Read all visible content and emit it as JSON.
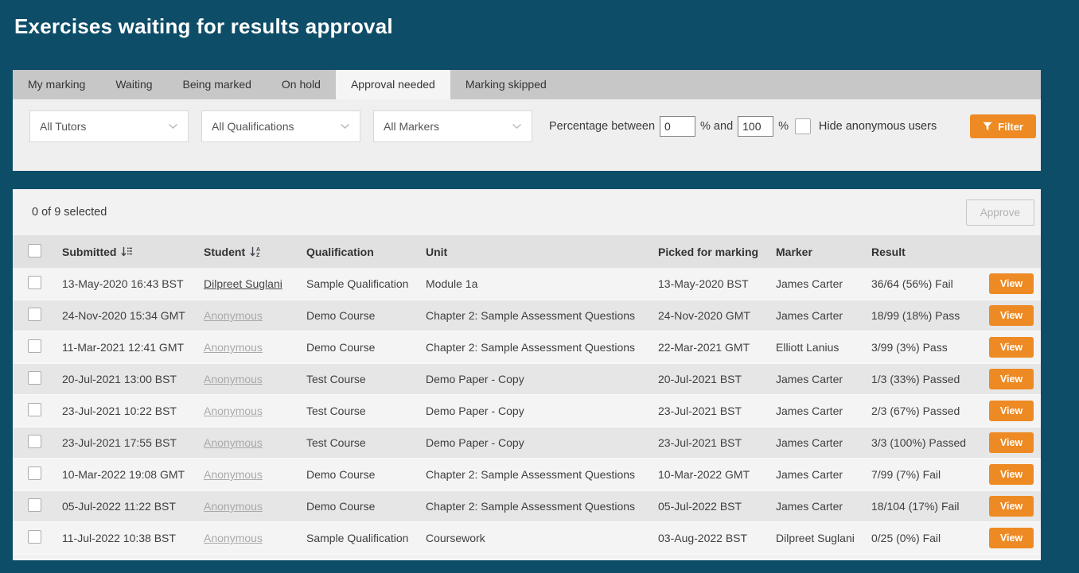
{
  "page": {
    "title": "Exercises waiting for results approval"
  },
  "tabs": [
    {
      "label": "My marking",
      "active": false
    },
    {
      "label": "Waiting",
      "active": false
    },
    {
      "label": "Being marked",
      "active": false
    },
    {
      "label": "On hold",
      "active": false
    },
    {
      "label": "Approval needed",
      "active": true
    },
    {
      "label": "Marking skipped",
      "active": false
    }
  ],
  "filters": {
    "tutors_dropdown": "All Tutors",
    "qualifications_dropdown": "All Qualifications",
    "markers_dropdown": "All Markers",
    "percentage_label": "Percentage between",
    "percentage_min": "0",
    "percent_and_label": "% and",
    "percentage_max": "100",
    "percent_label": "%",
    "hide_anonymous_label": "Hide anonymous users",
    "filter_button_label": "Filter"
  },
  "selection_bar": {
    "summary": "0 of 9 selected",
    "approve_button_label": "Approve"
  },
  "table": {
    "headers": {
      "submitted": "Submitted",
      "student": "Student",
      "qualification": "Qualification",
      "unit": "Unit",
      "picked": "Picked for marking",
      "marker": "Marker",
      "result": "Result"
    },
    "view_button_label": "View",
    "rows": [
      {
        "submitted": "13-May-2020 16:43 BST",
        "student": "Dilpreet Suglani",
        "anonymous": false,
        "qualification": "Sample Qualification",
        "unit": "Module 1a",
        "picked": "13-May-2020 BST",
        "marker": "James Carter",
        "result": "36/64 (56%) Fail"
      },
      {
        "submitted": "24-Nov-2020 15:34 GMT",
        "student": "Anonymous",
        "anonymous": true,
        "qualification": "Demo Course",
        "unit": "Chapter 2: Sample Assessment Questions",
        "picked": "24-Nov-2020 GMT",
        "marker": "James Carter",
        "result": "18/99 (18%) Pass"
      },
      {
        "submitted": "11-Mar-2021 12:41 GMT",
        "student": "Anonymous",
        "anonymous": true,
        "qualification": "Demo Course",
        "unit": "Chapter 2: Sample Assessment Questions",
        "picked": "22-Mar-2021 GMT",
        "marker": "Elliott Lanius",
        "result": "3/99 (3%) Pass"
      },
      {
        "submitted": "20-Jul-2021 13:00 BST",
        "student": "Anonymous",
        "anonymous": true,
        "qualification": "Test Course",
        "unit": "Demo Paper - Copy",
        "picked": "20-Jul-2021 BST",
        "marker": "James Carter",
        "result": "1/3 (33%) Passed"
      },
      {
        "submitted": "23-Jul-2021 10:22 BST",
        "student": "Anonymous",
        "anonymous": true,
        "qualification": "Test Course",
        "unit": "Demo Paper - Copy",
        "picked": "23-Jul-2021 BST",
        "marker": "James Carter",
        "result": "2/3 (67%) Passed"
      },
      {
        "submitted": "23-Jul-2021 17:55 BST",
        "student": "Anonymous",
        "anonymous": true,
        "qualification": "Test Course",
        "unit": "Demo Paper - Copy",
        "picked": "23-Jul-2021 BST",
        "marker": "James Carter",
        "result": "3/3 (100%) Passed"
      },
      {
        "submitted": "10-Mar-2022 19:08 GMT",
        "student": "Anonymous",
        "anonymous": true,
        "qualification": "Demo Course",
        "unit": "Chapter 2: Sample Assessment Questions",
        "picked": "10-Mar-2022 GMT",
        "marker": "James Carter",
        "result": "7/99 (7%) Fail"
      },
      {
        "submitted": "05-Jul-2022 11:22 BST",
        "student": "Anonymous",
        "anonymous": true,
        "qualification": "Demo Course",
        "unit": "Chapter 2: Sample Assessment Questions",
        "picked": "05-Jul-2022 BST",
        "marker": "James Carter",
        "result": "18/104 (17%) Fail"
      },
      {
        "submitted": "11-Jul-2022 10:38 BST",
        "student": "Anonymous",
        "anonymous": true,
        "qualification": "Sample Qualification",
        "unit": "Coursework",
        "picked": "03-Aug-2022 BST",
        "marker": "Dilpreet Suglani",
        "result": "0/25 (0%) Fail"
      }
    ]
  },
  "colors": {
    "page_background": "#0E4D68",
    "accent_orange": "#EE8A23",
    "tab_bar": "#C7C7C7",
    "panel_light": "#EFEFEF",
    "header_row": "#E1E1E1",
    "row_dark": "#E6E6E6",
    "row_light": "#F4F4F4"
  }
}
